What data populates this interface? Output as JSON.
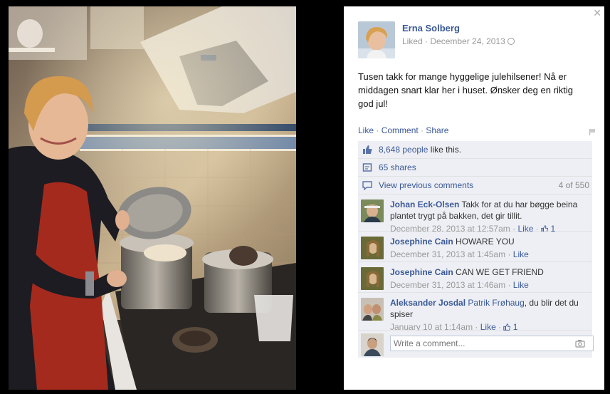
{
  "post": {
    "author": "Erna Solberg",
    "status": "Liked",
    "date": "December 24, 2013",
    "text": "Tusen takk for mange hyggelige julehilsener! Nå er middagen snart klar her i huset. Ønsker deg en riktig god jul!"
  },
  "actions": {
    "like": "Like",
    "comment": "Comment",
    "share": "Share"
  },
  "summary": {
    "likes_count": "8,648 people",
    "likes_suffix": "like this.",
    "shares": "65 shares",
    "view_previous": "View previous comments",
    "comment_count": "4 of 550"
  },
  "comments": [
    {
      "name": "Johan Eck-Olsen",
      "text": "Takk for at du har bøgge beina plantet trygt på bakken, det gir tillit.",
      "date": "December 28, 2013 at 12:57am",
      "like": "Like",
      "likes": "1"
    },
    {
      "name": "Josephine Cain",
      "text": "HOWARE YOU",
      "date": "December 31, 2013 at 1:45am",
      "like": "Like"
    },
    {
      "name": "Josephine Cain",
      "text": "CAN WE GET FRIEND",
      "date": "December 31, 2013 at 1:46am",
      "like": "Like"
    },
    {
      "name": "Aleksander Josdal",
      "tag": "Patrik Frøhaug",
      "text": ", du blir det du spiser",
      "date": "January 10 at 1:14am",
      "like": "Like",
      "likes": "1"
    }
  ],
  "write_comment_placeholder": "Write a comment...",
  "colors": {
    "link": "#3b5998",
    "ufi_bg": "#edeff4",
    "panel_bg": "#ffffff",
    "backdrop": "#000000"
  },
  "icons": [
    "close-icon",
    "globe-icon",
    "flag-icon",
    "thumbs-up-icon",
    "share-icon",
    "comment-icon",
    "camera-icon"
  ]
}
